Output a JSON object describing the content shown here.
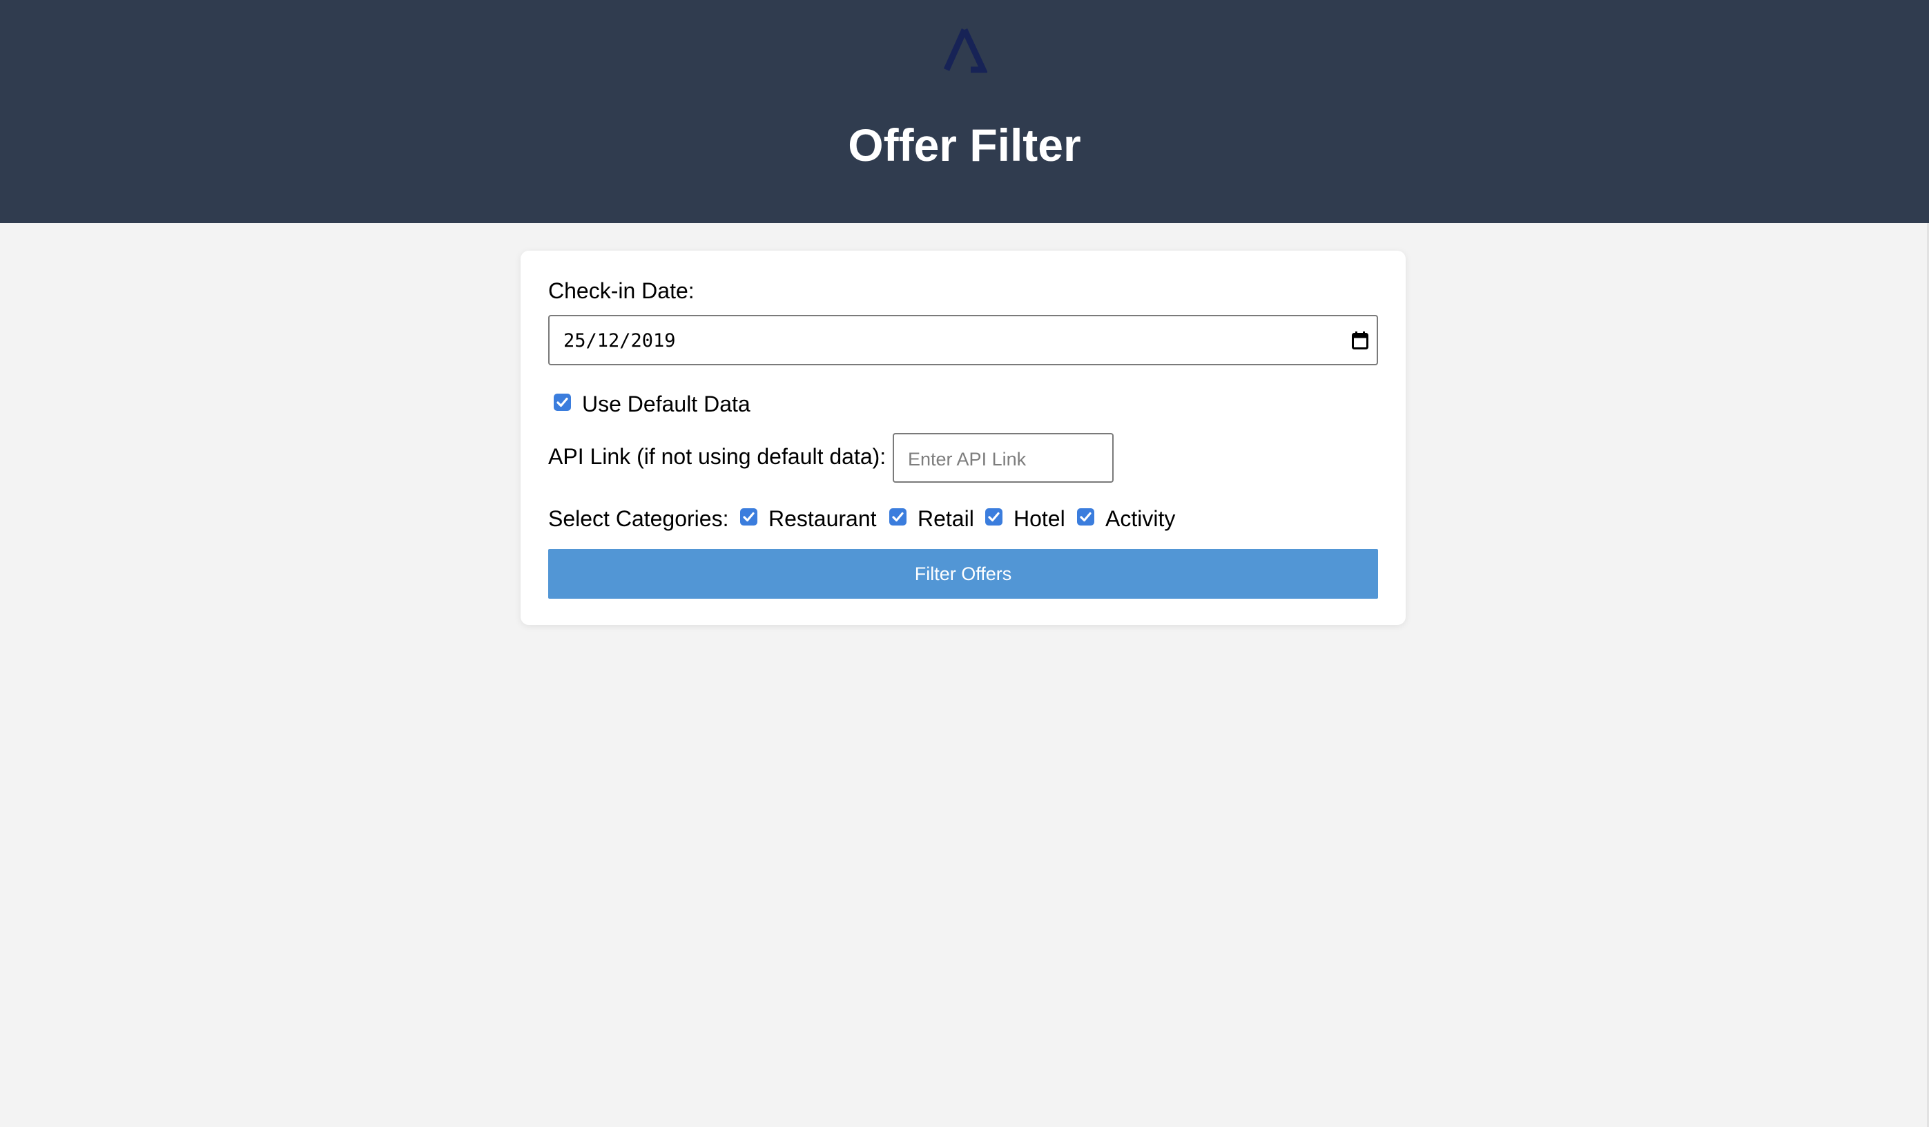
{
  "header": {
    "title": "Offer Filter",
    "logo_icon": "triangle-logo-icon",
    "background_color": "#303c4f"
  },
  "form": {
    "checkin_label": "Check-in Date:",
    "checkin_value": "25/12/2019",
    "calendar_icon": "calendar-icon",
    "use_default_label": "Use Default Data",
    "use_default_checked": true,
    "api_label": "API Link (if not using default data):",
    "api_placeholder": "Enter API Link",
    "api_value": "",
    "categories_label": "Select Categories:",
    "categories": [
      {
        "label": "Restaurant",
        "checked": true
      },
      {
        "label": "Retail",
        "checked": true
      },
      {
        "label": "Hotel",
        "checked": true
      },
      {
        "label": "Activity",
        "checked": true
      }
    ],
    "submit_label": "Filter Offers"
  },
  "colors": {
    "accent": "#5296d5",
    "checkbox": "#3b7ddd",
    "page_background": "#f3f3f3"
  }
}
